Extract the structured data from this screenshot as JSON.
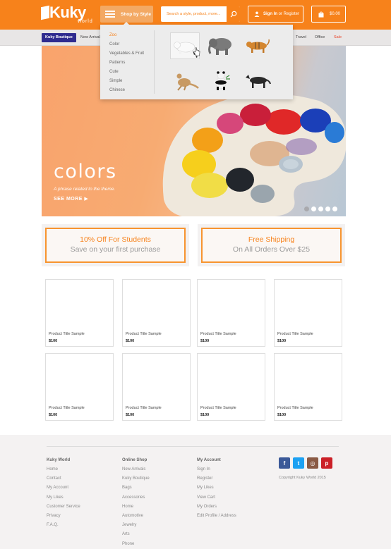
{
  "header": {
    "logo_text": "Kuky",
    "logo_sub": "world",
    "shop_by_style": "Shop by Style",
    "search_placeholder": "Search a style, product, more...",
    "sign_in": "Sign In",
    "sign_in_or": " or ",
    "register": "Register",
    "cart_total": "$0.00"
  },
  "categories": {
    "boutique": "Kuky Boutique",
    "items": [
      "New Arrivals",
      "Travel",
      "Office",
      "Sale"
    ]
  },
  "dropdown": {
    "styles": [
      "Zoo",
      "Color",
      "Vegetables & Fruit",
      "Patterns",
      "Cute",
      "Simple",
      "Chinese"
    ],
    "active_style": "Zoo",
    "animals": [
      "polar-bear",
      "elephant",
      "tiger",
      "kangaroo",
      "panda",
      "wolf"
    ]
  },
  "hero": {
    "headline": "colors",
    "subline": "A phrase related to the theme.",
    "cta": "SEE MORE",
    "slide_count": 5,
    "active_slide": 1
  },
  "promos": [
    {
      "line1": "10% Off For Students",
      "line2": "Save on your first purchase"
    },
    {
      "line1": "Free Shipping",
      "line2": "On All Orders Over $25"
    }
  ],
  "products": [
    {
      "title": "Product Title Sample",
      "price": "$100"
    },
    {
      "title": "Product Title Sample",
      "price": "$100"
    },
    {
      "title": "Product Title Sample",
      "price": "$100"
    },
    {
      "title": "Product Title Sample",
      "price": "$100"
    },
    {
      "title": "Product Title Sample",
      "price": "$100"
    },
    {
      "title": "Product Title Sample",
      "price": "$100"
    },
    {
      "title": "Product Title Sample",
      "price": "$100"
    },
    {
      "title": "Product Title Sample",
      "price": "$100"
    }
  ],
  "footer": {
    "columns": [
      {
        "heading": "Kuky World",
        "links": [
          "Home",
          "Contact",
          "My Account",
          "My Likes",
          "Customer Service",
          "Privacy",
          "F.A.Q."
        ]
      },
      {
        "heading": "Online Shop",
        "links": [
          "New Arrivals",
          "Kuky Boutique",
          "Bags",
          "Accessories",
          "Home",
          "Automotive",
          "Jewelry",
          "Arts",
          "Phone"
        ]
      },
      {
        "heading": "My Account",
        "links": [
          "Sign In",
          "Register",
          "My Likes",
          "View Cart",
          "My Orders",
          "Edit Profile / Address"
        ]
      }
    ],
    "social": [
      {
        "name": "facebook",
        "glyph": "f",
        "color": "#3b5998"
      },
      {
        "name": "twitter",
        "glyph": "t",
        "color": "#1da1f2"
      },
      {
        "name": "instagram",
        "glyph": "◎",
        "color": "#8a5a44"
      },
      {
        "name": "pinterest",
        "glyph": "p",
        "color": "#cb2027"
      }
    ],
    "copyright": "Copyright Kuky World 2015"
  },
  "colors": {
    "brand_orange": "#f7821b",
    "boutique_blue": "#2f2b8f",
    "sale_red": "#e8452a"
  }
}
